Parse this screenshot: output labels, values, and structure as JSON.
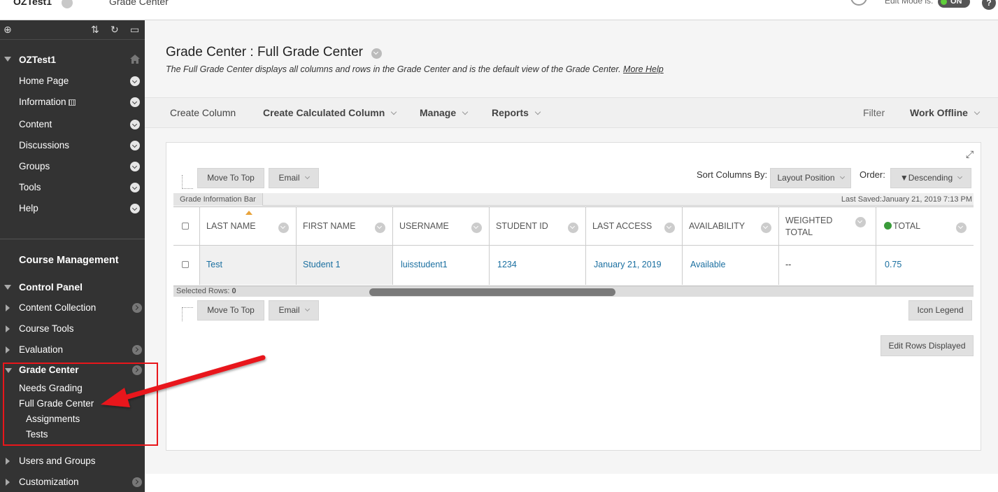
{
  "topbar": {
    "course_name": "OZTest1",
    "crumb": "Grade Center",
    "edit_mode_label": "Edit Mode is:",
    "edit_mode_state": "ON",
    "help_label": "?"
  },
  "sidebar": {
    "course_title": "OZTest1",
    "menu_items": [
      "Home Page",
      "Information",
      "Content",
      "Discussions",
      "Groups",
      "Tools",
      "Help"
    ],
    "course_management": "Course Management",
    "control_panel": "Control Panel",
    "control_items": [
      "Content Collection",
      "Course Tools",
      "Evaluation"
    ],
    "grade_center": "Grade Center",
    "grade_center_items": [
      "Needs Grading",
      "Full Grade Center"
    ],
    "grade_center_subitems": [
      "Assignments",
      "Tests"
    ],
    "bottom_items": [
      "Users and Groups",
      "Customization"
    ]
  },
  "page": {
    "title": "Grade Center : Full Grade Center",
    "description": "The Full Grade Center displays all columns and rows in the Grade Center and is the default view of the Grade Center.",
    "more_help": "More Help"
  },
  "actionbar": {
    "create_column": "Create Column",
    "create_calculated_column": "Create Calculated Column",
    "manage": "Manage",
    "reports": "Reports",
    "filter": "Filter",
    "work_offline": "Work Offline"
  },
  "grid": {
    "move_to_top": "Move To Top",
    "email": "Email",
    "sort_columns_by_label": "Sort Columns By:",
    "sort_columns_by_value": "Layout Position",
    "order_label": "Order:",
    "order_value": "▼Descending",
    "info_bar": "Grade Information Bar",
    "last_saved": "Last Saved:January 21, 2019 7:13 PM",
    "columns": [
      "LAST NAME",
      "FIRST NAME",
      "USERNAME",
      "STUDENT ID",
      "LAST ACCESS",
      "AVAILABILITY",
      "WEIGHTED TOTAL",
      "TOTAL"
    ],
    "rows": [
      [
        "Test",
        "Student 1",
        "luisstudent1",
        "1234",
        "January 21, 2019",
        "Available",
        "--",
        "0.75"
      ]
    ],
    "selected_rows_label": "Selected Rows:",
    "selected_rows_count": "0",
    "icon_legend": "Icon Legend",
    "edit_rows_displayed": "Edit Rows Displayed"
  },
  "colors": {
    "sidebar_bg": "#333333",
    "link": "#1a6fa0",
    "annotation": "#e8161b"
  }
}
